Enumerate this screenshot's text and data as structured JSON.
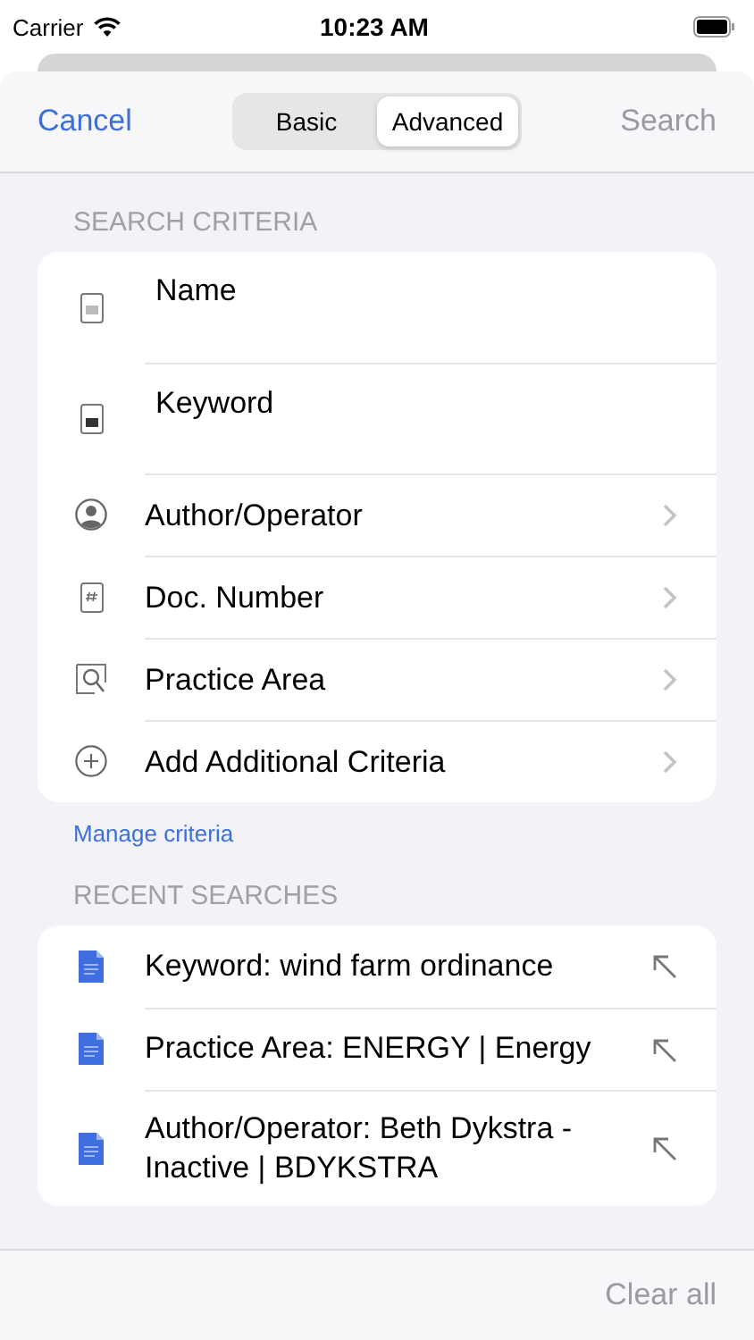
{
  "status_bar": {
    "carrier": "Carrier",
    "time": "10:23 AM"
  },
  "nav": {
    "cancel": "Cancel",
    "search": {
      "label": "Search",
      "disabled": true
    },
    "segments": [
      {
        "label": "Basic",
        "selected": false
      },
      {
        "label": "Advanced",
        "selected": true
      }
    ]
  },
  "criteria": {
    "header": "SEARCH CRITERIA",
    "items": [
      {
        "kind": "field",
        "label": "Name"
      },
      {
        "kind": "field",
        "label": "Keyword"
      },
      {
        "kind": "link",
        "label": "Author/Operator"
      },
      {
        "kind": "link",
        "label": "Doc. Number"
      },
      {
        "kind": "link",
        "label": "Practice Area"
      },
      {
        "kind": "link",
        "label": "Add Additional Criteria"
      }
    ],
    "footer_link": "Manage criteria"
  },
  "recent": {
    "header": "RECENT SEARCHES",
    "items": [
      {
        "label": "Keyword: wind farm ordinance"
      },
      {
        "label": "Practice Area: ENERGY | Energy"
      },
      {
        "label": "Author/Operator: Beth Dykstra - Inactive | BDYKSTRA"
      }
    ]
  },
  "bottom_bar": {
    "clear_all": {
      "label": "Clear all",
      "disabled": true
    }
  }
}
